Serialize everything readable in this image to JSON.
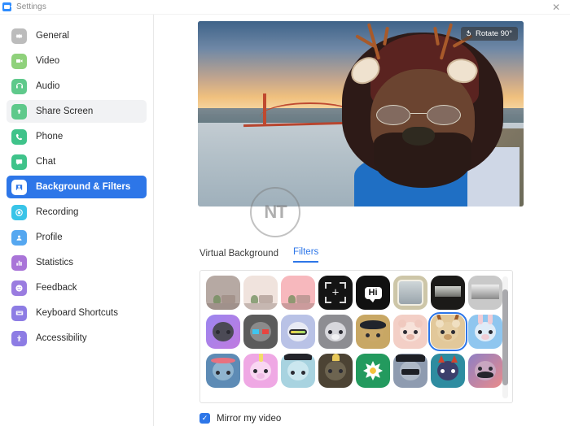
{
  "window": {
    "title": "Settings",
    "logo_icon": "zoom-camera-icon",
    "close_icon": "close-icon"
  },
  "sidebar": {
    "items": [
      {
        "label": "General",
        "icon": "gear-icon",
        "color": "#bcbcbc",
        "state": "normal"
      },
      {
        "label": "Video",
        "icon": "video-camera-icon",
        "color": "#8fd17b",
        "state": "normal"
      },
      {
        "label": "Audio",
        "icon": "headphones-icon",
        "color": "#5fc98b",
        "state": "normal"
      },
      {
        "label": "Share Screen",
        "icon": "share-screen-icon",
        "color": "#5fc98b",
        "state": "hovered"
      },
      {
        "label": "Phone",
        "icon": "phone-icon",
        "color": "#3fc38a",
        "state": "normal"
      },
      {
        "label": "Chat",
        "icon": "chat-bubble-icon",
        "color": "#3fc38a",
        "state": "normal"
      },
      {
        "label": "Background & Filters",
        "icon": "background-person-icon",
        "color": "#ffffff",
        "state": "active"
      },
      {
        "label": "Recording",
        "icon": "record-circle-icon",
        "color": "#39c4e8",
        "state": "normal"
      },
      {
        "label": "Profile",
        "icon": "profile-person-icon",
        "color": "#55a7f0",
        "state": "normal"
      },
      {
        "label": "Statistics",
        "icon": "bar-chart-icon",
        "color": "#a974d8",
        "state": "normal"
      },
      {
        "label": "Feedback",
        "icon": "smiley-face-icon",
        "color": "#9a7ce0",
        "state": "normal"
      },
      {
        "label": "Keyboard Shortcuts",
        "icon": "keyboard-icon",
        "color": "#8d7ce4",
        "state": "normal"
      },
      {
        "label": "Accessibility",
        "icon": "accessibility-icon",
        "color": "#8d7ce4",
        "state": "normal"
      }
    ]
  },
  "preview": {
    "rotate_label": "Rotate 90°",
    "rotate_icon": "rotate-icon",
    "background_name": "Golden Gate Bridge",
    "applied_filter": "Deer",
    "watermark_text": "NT"
  },
  "tabs": [
    {
      "label": "Virtual Background",
      "active": false
    },
    {
      "label": "Filters",
      "active": true
    }
  ],
  "filters": {
    "selected": "Deer",
    "rows": [
      [
        {
          "name": "None",
          "type": "scene",
          "tint": "#b6a9a3"
        },
        {
          "name": "Warm",
          "type": "scene",
          "tint": "#f0e3dd"
        },
        {
          "name": "Pink",
          "type": "scene",
          "tint": "#f7b8bd"
        },
        {
          "name": "Add Filter",
          "type": "frame",
          "tint": "#141414",
          "glyph": "+"
        },
        {
          "name": "Hi",
          "type": "text",
          "tint": "#111111",
          "glyph": "Hi"
        },
        {
          "name": "Soft Frame",
          "type": "border",
          "tint": "#cdc6a8"
        },
        {
          "name": "Dark Vignette",
          "type": "dark",
          "tint": "#1b1a18"
        },
        {
          "name": "Black & White",
          "type": "bw",
          "tint": "#c9c9c9"
        }
      ],
      [
        {
          "name": "VR Headset",
          "type": "face",
          "tint": "#8f78e8",
          "glyph": "🥽"
        },
        {
          "name": "3D Glasses",
          "type": "face",
          "tint": "#5b5b5b",
          "glyph": "👓"
        },
        {
          "name": "Ski Goggles",
          "type": "face",
          "tint": "#b9c2e6",
          "glyph": "🥽"
        },
        {
          "name": "Sheep",
          "type": "face",
          "tint": "#8d8d92",
          "glyph": "🐑"
        },
        {
          "name": "Pirate",
          "type": "face",
          "tint": "#c8a764",
          "glyph": "🏴"
        },
        {
          "name": "Bear",
          "type": "face",
          "tint": "#f3cfc6",
          "glyph": "🐻"
        },
        {
          "name": "Deer",
          "type": "face",
          "tint": "#e2c89a",
          "glyph": "🦌"
        },
        {
          "name": "Rabbit",
          "type": "face",
          "tint": "#8fc6ef",
          "glyph": "🐰"
        }
      ],
      [
        {
          "name": "Flower Crown",
          "type": "face",
          "tint": "#5d8bb5",
          "glyph": "🌼"
        },
        {
          "name": "Unicorn",
          "type": "face",
          "tint": "#efa8e4",
          "glyph": "🦄"
        },
        {
          "name": "Graduate",
          "type": "face",
          "tint": "#a8d3e0",
          "glyph": "🎓"
        },
        {
          "name": "Pineapple",
          "type": "face",
          "tint": "#4c4334",
          "glyph": "🍍"
        },
        {
          "name": "Daisy",
          "type": "face",
          "tint": "#239a5e",
          "glyph": "🌼"
        },
        {
          "name": "Bandit Hat",
          "type": "face",
          "tint": "#8e9bb0",
          "glyph": "🕵"
        },
        {
          "name": "Devil",
          "type": "face",
          "tint": "#2e8ca0",
          "glyph": "😈"
        },
        {
          "name": "Mustache",
          "type": "face",
          "tint": "#c98a9a",
          "glyph": "🥸"
        }
      ]
    ]
  },
  "mirror": {
    "label": "Mirror my video",
    "checked": true,
    "check_glyph": "✓"
  },
  "colors": {
    "accent": "#2d76e8",
    "hover": "#f1f2f4",
    "border": "#e2e2e2"
  }
}
